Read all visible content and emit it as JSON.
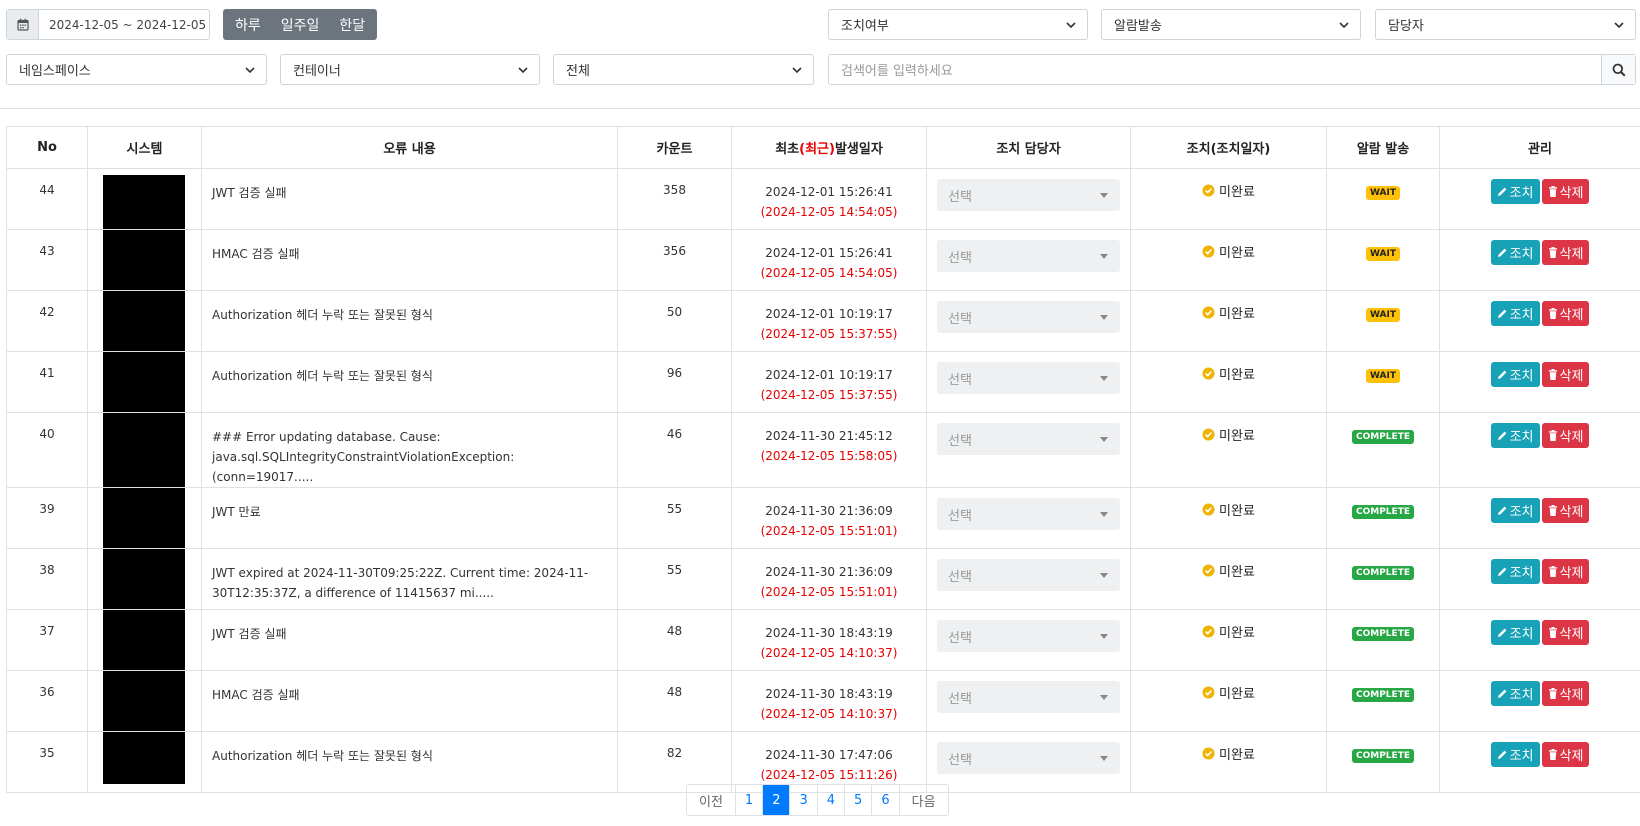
{
  "filters": {
    "date_range": "2024-12-05 ~ 2024-12-05",
    "range_buttons": [
      "하루",
      "일주일",
      "한달"
    ],
    "action_status": "조치여부",
    "alarm_send": "알람발송",
    "assignee": "담당자",
    "namespace": "네임스페이스",
    "container": "컨테이너",
    "scope": "전체",
    "search_placeholder": "검색어를 입력하세요"
  },
  "table": {
    "headers": {
      "no": "No",
      "system": "시스템",
      "content": "오류 내용",
      "count": "카운트",
      "date_prefix": "최초",
      "date_highlight": "(최근)",
      "date_suffix": "발생일자",
      "manager": "조치 담당자",
      "action": "조치(조치일자)",
      "alarm": "알람 발송",
      "manage": "관리"
    },
    "select_placeholder": "선택",
    "status_label": "미완료",
    "action_label": "조치",
    "delete_label": "삭제",
    "rows": [
      {
        "no": "44",
        "msg1": "JWT 검증 실패",
        "msg2": "",
        "count": "358",
        "first": "2024-12-01 15:26:41",
        "recent": "(2024-12-05 14:54:05)",
        "alarm": "WAIT"
      },
      {
        "no": "43",
        "msg1": "HMAC 검증 실패",
        "msg2": "",
        "count": "356",
        "first": "2024-12-01 15:26:41",
        "recent": "(2024-12-05 14:54:05)",
        "alarm": "WAIT"
      },
      {
        "no": "42",
        "msg1": "Authorization 헤더 누락 또는 잘못된 형식",
        "msg2": "",
        "count": "50",
        "first": "2024-12-01 10:19:17",
        "recent": "(2024-12-05 15:37:55)",
        "alarm": "WAIT"
      },
      {
        "no": "41",
        "msg1": "Authorization 헤더 누락 또는 잘못된 형식",
        "msg2": "",
        "count": "96",
        "first": "2024-12-01 10:19:17",
        "recent": "(2024-12-05 15:37:55)",
        "alarm": "WAIT"
      },
      {
        "no": "40",
        "msg1": "### Error updating database. Cause:",
        "msg2": "java.sql.SQLIntegrityConstraintViolationException: (conn=19017.....",
        "count": "46",
        "first": "2024-11-30 21:45:12",
        "recent": "(2024-12-05 15:58:05)",
        "alarm": "COMPLETE"
      },
      {
        "no": "39",
        "msg1": "JWT 만료",
        "msg2": "",
        "count": "55",
        "first": "2024-11-30 21:36:09",
        "recent": "(2024-12-05 15:51:01)",
        "alarm": "COMPLETE"
      },
      {
        "no": "38",
        "msg1": "JWT expired at 2024-11-30T09:25:22Z. Current time: 2024-11-",
        "msg2": "30T12:35:37Z, a difference of 11415637 mi.....",
        "count": "55",
        "first": "2024-11-30 21:36:09",
        "recent": "(2024-12-05 15:51:01)",
        "alarm": "COMPLETE"
      },
      {
        "no": "37",
        "msg1": "JWT 검증 실패",
        "msg2": "",
        "count": "48",
        "first": "2024-11-30 18:43:19",
        "recent": "(2024-12-05 14:10:37)",
        "alarm": "COMPLETE"
      },
      {
        "no": "36",
        "msg1": "HMAC 검증 실패",
        "msg2": "",
        "count": "48",
        "first": "2024-11-30 18:43:19",
        "recent": "(2024-12-05 14:10:37)",
        "alarm": "COMPLETE"
      },
      {
        "no": "35",
        "msg1": "Authorization 헤더 누락 또는 잘못된 형식",
        "msg2": "",
        "count": "82",
        "first": "2024-11-30 17:47:06",
        "recent": "(2024-12-05 15:11:26)",
        "alarm": "COMPLETE"
      }
    ]
  },
  "pagination": {
    "prev": "이전",
    "pages": [
      "1",
      "2",
      "3",
      "4",
      "5",
      "6"
    ],
    "current": "2",
    "next": "다음"
  },
  "icons": {
    "calendar": "calendar-icon",
    "search": "search-icon",
    "check": "check-circle-icon",
    "pencil": "pencil-icon",
    "trash": "trash-icon"
  },
  "colors": {
    "range_bg": "#6c757d",
    "action_btn": "#17a2b8",
    "delete_btn": "#dc3545",
    "wait_badge": "#ffc107",
    "complete_badge": "#28a745",
    "recent_date": "#e60000",
    "status_check": "#f0b400",
    "page_active": "#007bff"
  }
}
